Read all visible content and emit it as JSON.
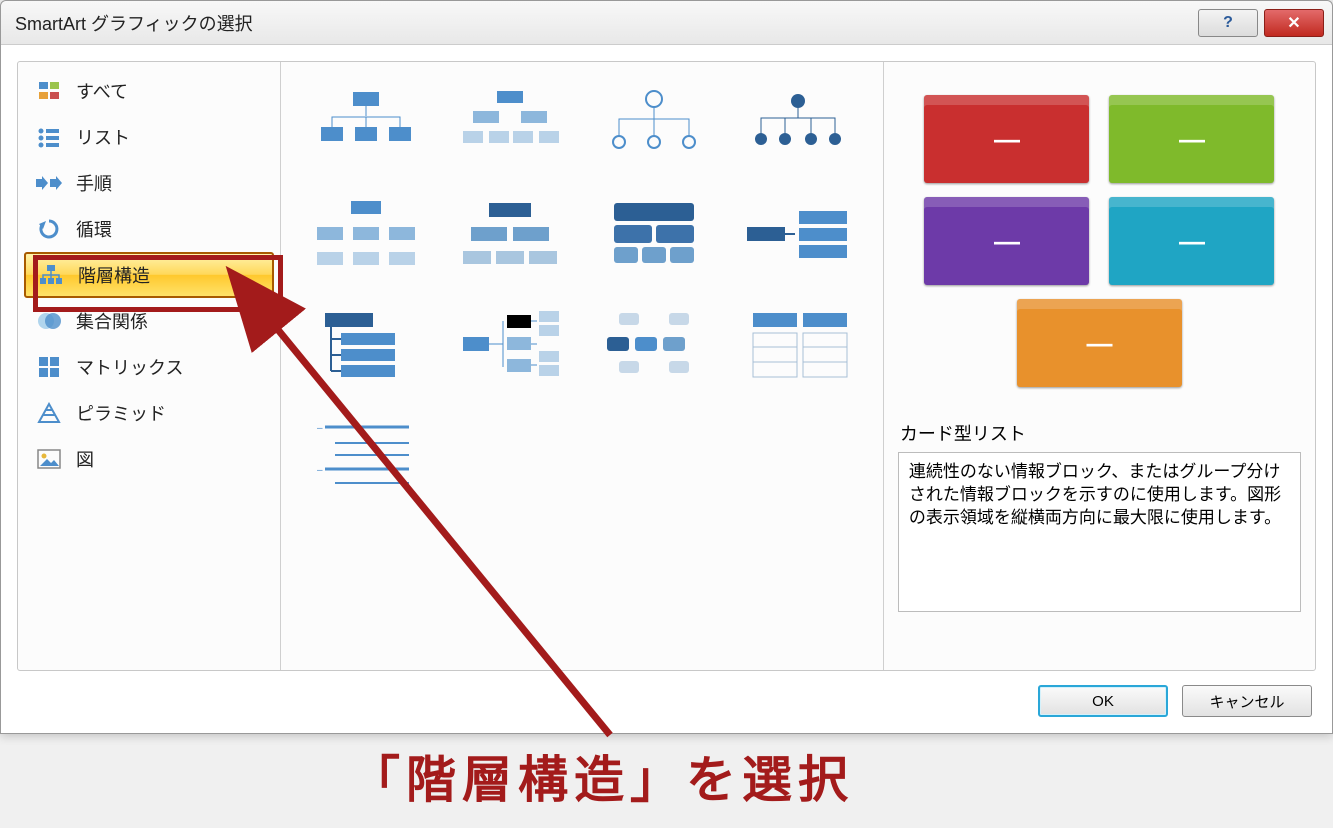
{
  "title": "SmartArt グラフィックの選択",
  "categories": [
    {
      "label": "すべて",
      "icon": "all"
    },
    {
      "label": "リスト",
      "icon": "list"
    },
    {
      "label": "手順",
      "icon": "process"
    },
    {
      "label": "循環",
      "icon": "cycle"
    },
    {
      "label": "階層構造",
      "icon": "hierarchy",
      "selected": true
    },
    {
      "label": "集合関係",
      "icon": "relationship"
    },
    {
      "label": "マトリックス",
      "icon": "matrix"
    },
    {
      "label": "ピラミッド",
      "icon": "pyramid"
    },
    {
      "label": "図",
      "icon": "picture"
    }
  ],
  "preview": {
    "cards": [
      {
        "color": "#c92f2f"
      },
      {
        "color": "#7fba2b"
      },
      {
        "color": "#6d3aa8"
      },
      {
        "color": "#1fa5c4"
      },
      {
        "color": "#e8912c"
      }
    ],
    "title": "カード型リスト",
    "description": "連続性のない情報ブロック、またはグループ分けされた情報ブロックを示すのに使用します。図形の表示領域を縦横両方向に最大限に使用します。"
  },
  "buttons": {
    "ok": "OK",
    "cancel": "キャンセル"
  },
  "annotation": "「階層構造」を選択"
}
